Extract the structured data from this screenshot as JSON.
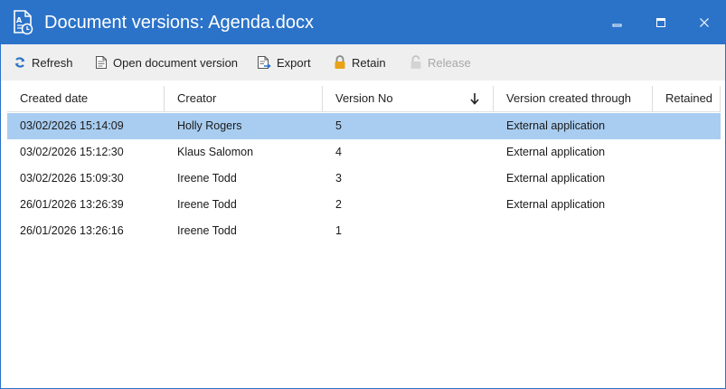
{
  "window": {
    "title": "Document versions: Agenda.docx",
    "minimize_label": "Minimize",
    "maximize_label": "Maximize",
    "close_label": "Close"
  },
  "toolbar": {
    "refresh": "Refresh",
    "open_version": "Open document version",
    "export": "Export",
    "retain": "Retain",
    "release": "Release"
  },
  "table": {
    "columns": [
      "Created date",
      "Creator",
      "Version No",
      "Version created through",
      "Retained"
    ],
    "sort_column": "Version No",
    "sort_direction": "descending",
    "selected_row": 0,
    "rows": [
      {
        "created": "03/02/2026 15:14:09",
        "creator": "Holly Rogers",
        "version": "5",
        "through": "External application",
        "retained": ""
      },
      {
        "created": "03/02/2026 15:12:30",
        "creator": "Klaus Salomon",
        "version": "4",
        "through": "External application",
        "retained": ""
      },
      {
        "created": "03/02/2026 15:09:30",
        "creator": "Ireene Todd",
        "version": "3",
        "through": "External application",
        "retained": ""
      },
      {
        "created": "26/01/2026 13:26:39",
        "creator": "Ireene Todd",
        "version": "2",
        "through": "External application",
        "retained": ""
      },
      {
        "created": "26/01/2026 13:26:16",
        "creator": "Ireene Todd",
        "version": "1",
        "through": "",
        "retained": ""
      }
    ]
  },
  "colors": {
    "titlebar": "#2b73c9",
    "toolbar": "#efefef",
    "selection": "#a9cdf0",
    "retain_icon": "#e8a317"
  }
}
